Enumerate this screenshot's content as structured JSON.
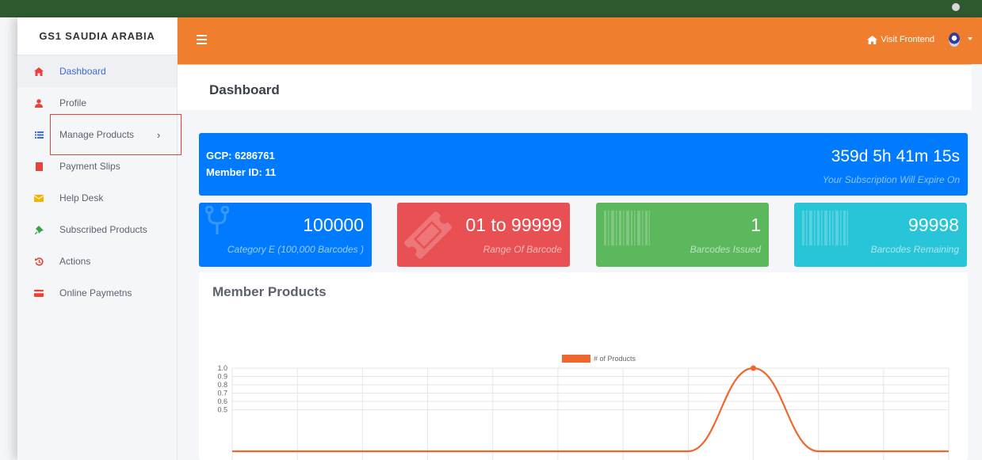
{
  "app": {
    "brand": "GS1 SAUDIA ARABIA",
    "accent_color": "#ef7f2e",
    "primary_color": "#007bff"
  },
  "sidebar": {
    "items": [
      {
        "label": "Dashboard",
        "icon": "home-icon",
        "active": true
      },
      {
        "label": "Profile",
        "icon": "user-icon"
      },
      {
        "label": "Manage Products",
        "icon": "list-icon",
        "has_submenu": true
      },
      {
        "label": "Payment Slips",
        "icon": "file-icon"
      },
      {
        "label": "Help Desk",
        "icon": "envelope-icon"
      },
      {
        "label": "Subscribed Products",
        "icon": "thumbtack-icon"
      },
      {
        "label": "Actions",
        "icon": "history-icon"
      },
      {
        "label": "Online Paymetns",
        "icon": "credit-card-icon"
      }
    ]
  },
  "topbar": {
    "visit_label": "Visit Frontend"
  },
  "page": {
    "title": "Dashboard"
  },
  "banner": {
    "gcp": "GCP: 6286761",
    "member_id": "Member ID: 11",
    "countdown": "359d 5h 41m 15s",
    "expiry_text": "Your Subscription Will Expire On"
  },
  "cards": [
    {
      "value": "100000",
      "label": "Category E (100,000 Barcodes )",
      "icon": "fork-icon"
    },
    {
      "value": "01 to 99999",
      "label": "Range Of Barcode",
      "icon": "ticket-icon"
    },
    {
      "value": "1",
      "label": "Barcodes Issued",
      "icon": "barcode-icon"
    },
    {
      "value": "99998",
      "label": "Barcodes Remaining",
      "icon": "barcode-icon"
    }
  ],
  "panel": {
    "title": "Member Products"
  },
  "chart_data": {
    "type": "line",
    "series": [
      {
        "name": "# of Products",
        "color": "#f0672e",
        "values": [
          0,
          0,
          0,
          0,
          0,
          0,
          0,
          0,
          1,
          0,
          0,
          0
        ]
      }
    ],
    "y_ticks": [
      "1.0",
      "0.9",
      "0.8",
      "0.7",
      "0.6",
      "0.5"
    ],
    "ylim": [
      0,
      1
    ],
    "grid": true,
    "legend": "top-center"
  }
}
